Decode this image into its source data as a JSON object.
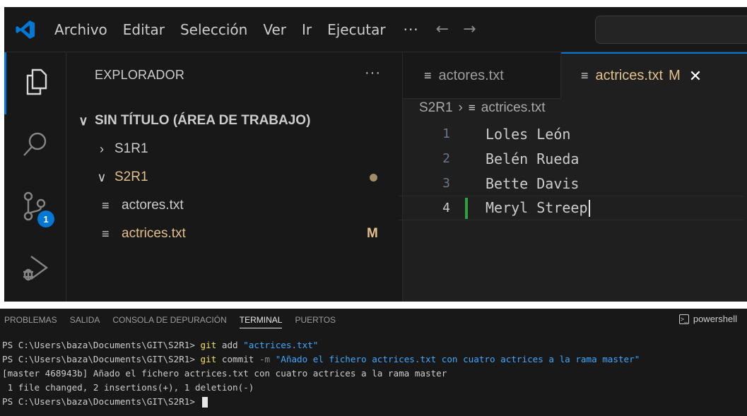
{
  "menubar": {
    "items": [
      "Archivo",
      "Editar",
      "Selección",
      "Ver",
      "Ir",
      "Ejecutar"
    ],
    "more": "···",
    "back": "←",
    "forward": "→",
    "logo_color": "#0078d4"
  },
  "activity_bar": {
    "scm_badge": "1",
    "icons": [
      "files-icon",
      "search-icon",
      "source-control-icon",
      "run-debug-icon"
    ]
  },
  "sidebar": {
    "title": "EXPLORADOR",
    "more": "···",
    "workspace": "SIN TÍTULO (ÁREA DE TRABAJO)",
    "folders": [
      {
        "label": "S1R1",
        "expanded": false
      },
      {
        "label": "S2R1",
        "expanded": true
      }
    ],
    "files": [
      {
        "label": "actores.txt",
        "status": ""
      },
      {
        "label": "actrices.txt",
        "status": "M"
      }
    ]
  },
  "tabs": [
    {
      "label": "actores.txt",
      "active": false
    },
    {
      "label": "actrices.txt",
      "active": true,
      "badge": "M",
      "close": "✕"
    }
  ],
  "breadcrumb": {
    "folder": "S2R1",
    "separator": "›",
    "file": "actrices.txt"
  },
  "editor": {
    "lines": [
      {
        "number": "1",
        "text": "Loles León"
      },
      {
        "number": "2",
        "text": "Belén Rueda"
      },
      {
        "number": "3",
        "text": "Bette Davis"
      },
      {
        "number": "4",
        "text": "Meryl Streep"
      }
    ]
  },
  "panel": {
    "tabs": [
      "PROBLEMAS",
      "SALIDA",
      "CONSOLA DE DEPURACIÓN",
      "TERMINAL",
      "PUERTOS"
    ],
    "active_tab": "TERMINAL",
    "shell": "powershell",
    "terminal": {
      "prompt": "PS C:\\Users\\baza\\Documents\\GIT\\S2R1> ",
      "cmd1_git": "git",
      "cmd1_rest": " add ",
      "cmd1_arg": "\"actrices.txt\"",
      "cmd2_git": "git",
      "cmd2_rest": " commit ",
      "cmd2_flag": "-m",
      "cmd2_arg": " \"Añado el fichero actrices.txt con cuatro actrices a la rama master\"",
      "out1": "[master 468943b] Añado el fichero actrices.txt con cuatro actrices a la rama master",
      "out2": " 1 file changed, 2 insertions(+), 1 deletion(-)"
    }
  }
}
